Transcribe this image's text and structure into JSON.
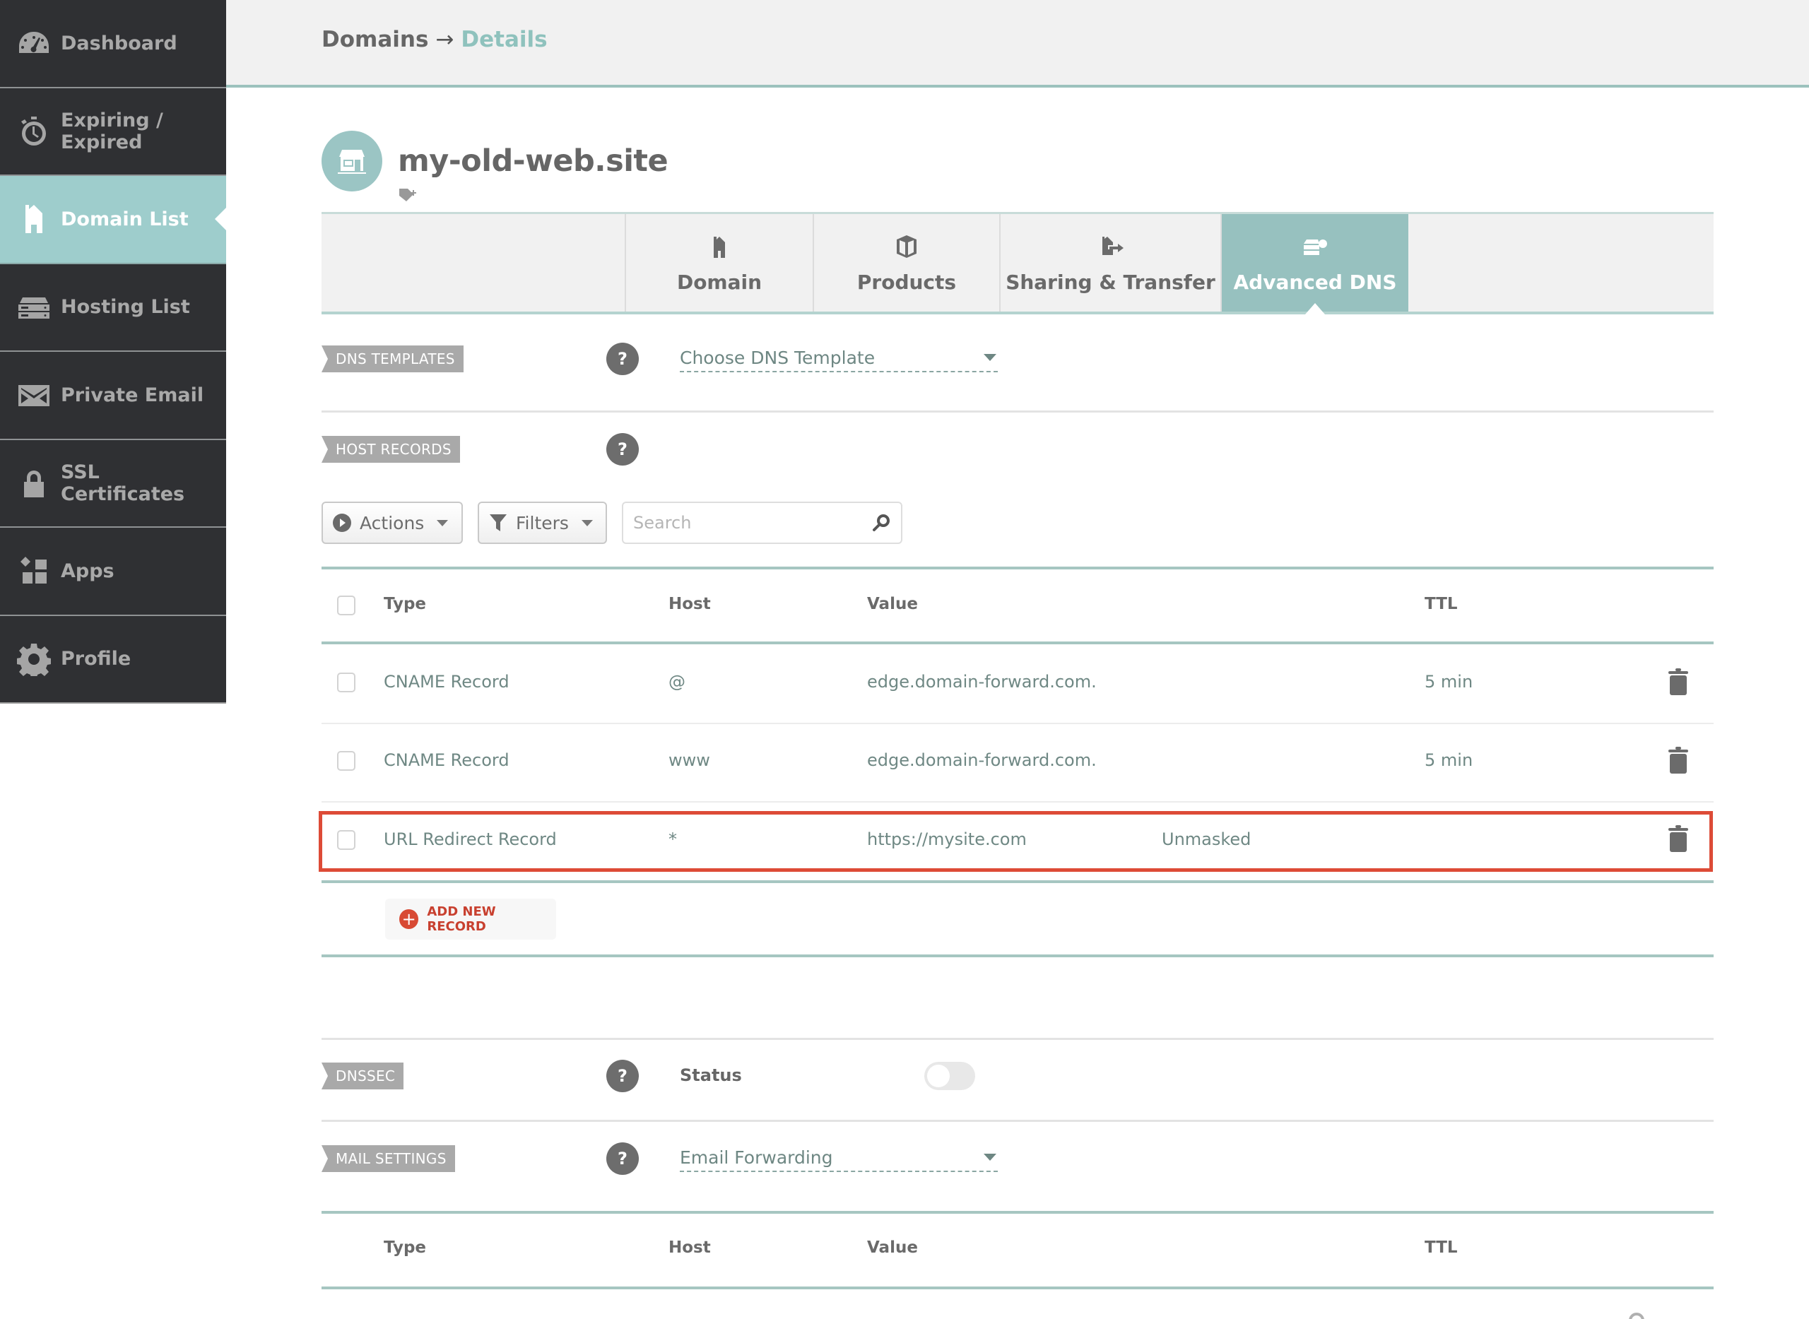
{
  "sidebar": {
    "items": [
      {
        "label": "Dashboard",
        "icon": "dashboard-gauge-icon",
        "active": false
      },
      {
        "label": "Expiring / Expired",
        "icon": "stopwatch-icon",
        "active": false
      },
      {
        "label": "Domain List",
        "icon": "house-icon",
        "active": true
      },
      {
        "label": "Hosting List",
        "icon": "server-icon",
        "active": false
      },
      {
        "label": "Private Email",
        "icon": "envelope-icon",
        "active": false
      },
      {
        "label": "SSL Certificates",
        "icon": "lock-icon",
        "active": false
      },
      {
        "label": "Apps",
        "icon": "apps-grid-icon",
        "active": false
      },
      {
        "label": "Profile",
        "icon": "gear-icon",
        "active": false
      }
    ]
  },
  "header": {
    "breadcrumb": {
      "parent": "Domains",
      "separator": "→",
      "current": "Details"
    }
  },
  "domain": {
    "name": "my-old-web.site",
    "avatar_icon": "storefront-icon",
    "tag_icon": "add-tag-icon"
  },
  "tabs": [
    {
      "label": "Domain",
      "icon": "house-icon",
      "active": false
    },
    {
      "label": "Products",
      "icon": "box-icon",
      "active": false
    },
    {
      "label": "Sharing & Transfer",
      "icon": "house-transfer-icon",
      "active": false
    },
    {
      "label": "Advanced DNS",
      "icon": "dns-server-icon",
      "active": true
    }
  ],
  "dns_templates": {
    "label": "DNS TEMPLATES",
    "help": "?",
    "dropdown_value": "Choose DNS Template"
  },
  "host_records": {
    "label": "HOST RECORDS",
    "help": "?",
    "toolbar": {
      "actions_label": "Actions",
      "filters_label": "Filters",
      "search_placeholder": "Search"
    },
    "columns": [
      "Type",
      "Host",
      "Value",
      "TTL"
    ],
    "rows": [
      {
        "type": "CNAME Record",
        "host": "@",
        "value": "edge.domain-forward.com.",
        "extra": "",
        "ttl": "5 min",
        "highlighted": false
      },
      {
        "type": "CNAME Record",
        "host": "www",
        "value": "edge.domain-forward.com.",
        "extra": "",
        "ttl": "5 min",
        "highlighted": false
      },
      {
        "type": "URL Redirect Record",
        "host": "*",
        "value": "https://mysite.com",
        "extra": "Unmasked",
        "ttl": "",
        "highlighted": true
      }
    ],
    "add_record_label": "ADD NEW RECORD"
  },
  "dnssec": {
    "label": "DNSSEC",
    "help": "?",
    "status_label": "Status",
    "enabled": false
  },
  "mail_settings": {
    "label": "MAIL SETTINGS",
    "help": "?",
    "dropdown_value": "Email Forwarding",
    "columns": [
      "Type",
      "Host",
      "Value",
      "TTL"
    ]
  },
  "colors": {
    "accent": "#97c1bf",
    "sidebar_bg": "#2f3033",
    "highlight_border": "#dd4b37",
    "add_button": "#d84a34"
  }
}
